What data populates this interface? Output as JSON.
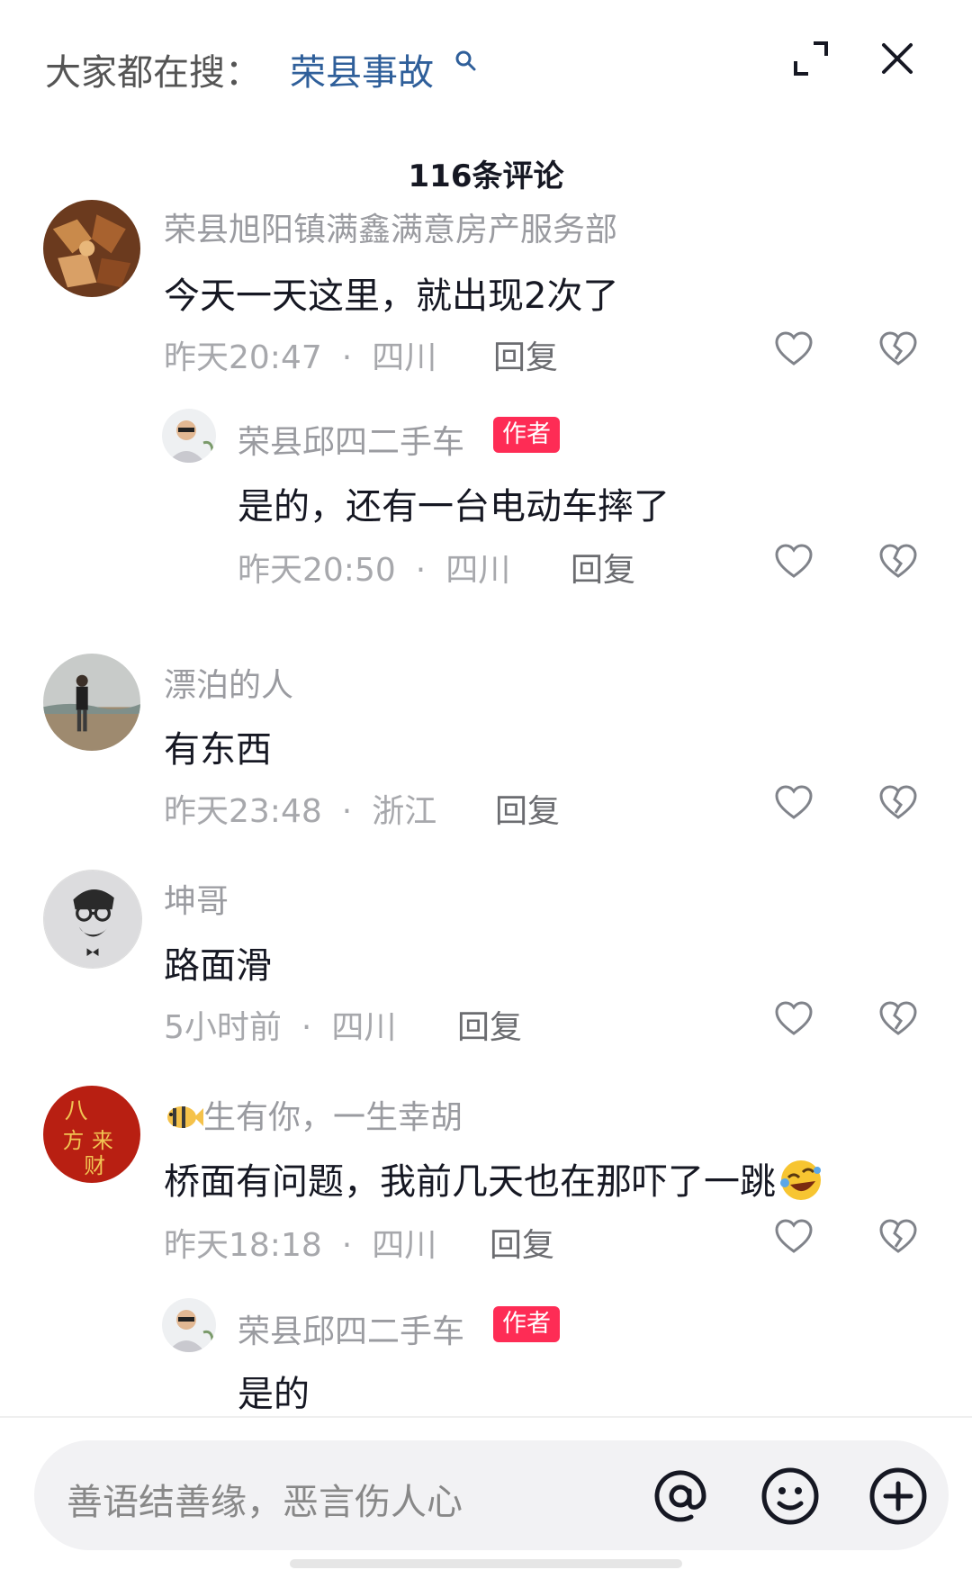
{
  "header": {
    "search_prefix": "大家都在搜：",
    "search_term": "荣县事故",
    "icons": [
      "search-icon",
      "expand-icon",
      "close-icon"
    ]
  },
  "comment_count": "116条评论",
  "comments": [
    {
      "name": "荣县旭阳镇满鑫满意房产服务部",
      "text": "今天一天这里，就出现2次了",
      "time": "昨天20:47",
      "location": "四川",
      "reply_label": "回复",
      "replies": [
        {
          "name": "荣县邱四二手车",
          "badge": "作者",
          "text": "是的，还有一台电动车摔了",
          "time": "昨天20:50",
          "location": "四川",
          "reply_label": "回复"
        }
      ]
    },
    {
      "name": "漂泊的人",
      "text": "有东西",
      "time": "昨天23:48",
      "location": "浙江",
      "reply_label": "回复"
    },
    {
      "name": "坤哥",
      "text": "路面滑",
      "time": "5小时前",
      "location": "四川",
      "reply_label": "回复"
    },
    {
      "name": "生有你，一生幸胡",
      "name_prefix_icon": "fish-emoji-icon",
      "text": "桥面有问题，我前几天也在那吓了一跳",
      "text_suffix_icon": "rolling-laugh-emoji-icon",
      "time": "昨天18:18",
      "location": "四川",
      "reply_label": "回复",
      "replies": [
        {
          "name": "荣县邱四二手车",
          "badge": "作者",
          "text": "是的"
        }
      ]
    }
  ],
  "input": {
    "placeholder": "善语结善缘，恶言伤人心",
    "icons": [
      "at-icon",
      "emoji-icon",
      "plus-icon"
    ]
  },
  "colors": {
    "search_term": "#2f5f9a",
    "author_badge": "#fe2c55",
    "meta_text": "#a7a8ac"
  }
}
